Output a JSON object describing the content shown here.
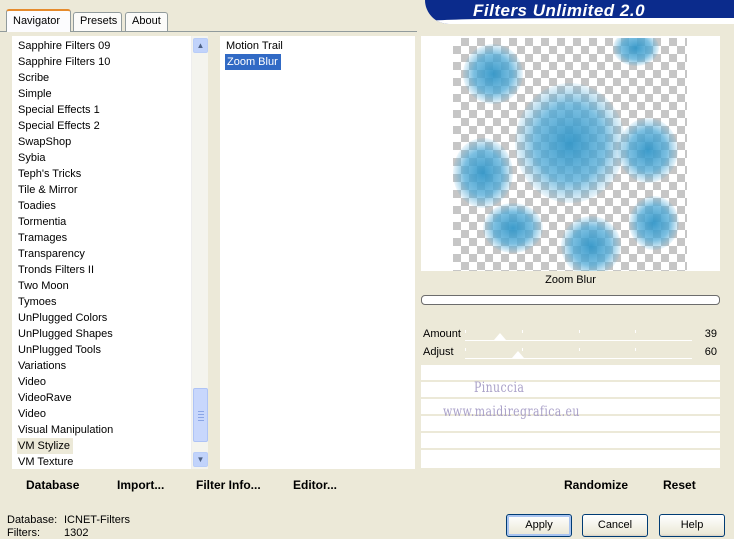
{
  "tabs": [
    {
      "label": "Navigator",
      "active": true
    },
    {
      "label": "Presets",
      "active": false
    },
    {
      "label": "About",
      "active": false
    }
  ],
  "banner": {
    "title": "Filters Unlimited 2.0"
  },
  "categories": {
    "items": [
      "Sapphire Filters 09",
      "Sapphire Filters 10",
      "Scribe",
      "Simple",
      "Special Effects 1",
      "Special Effects 2",
      "SwapShop",
      "Sybia",
      "Teph's Tricks",
      "Tile & Mirror",
      "Toadies",
      "Tormentia",
      "Tramages",
      "Transparency",
      "Tronds Filters II",
      "Two Moon",
      "Tymoes",
      "UnPlugged Colors",
      "UnPlugged Shapes",
      "UnPlugged Tools",
      "Variations",
      "Video",
      "VideoRave",
      "Video",
      "Visual Manipulation",
      "VM Stylize",
      "VM Texture"
    ],
    "selected_index": 25,
    "scroll_up_icon": "chevron-up-icon",
    "scroll_down_icon": "chevron-down-icon"
  },
  "filters": {
    "items": [
      "Motion Trail",
      "Zoom Blur"
    ],
    "selected_index": 1
  },
  "preview": {
    "filter_name": "Zoom Blur",
    "accent_color": "#3a9ccc"
  },
  "sliders": [
    {
      "label": "Amount",
      "value": "39",
      "level": 39
    },
    {
      "label": "Adjust",
      "value": "60",
      "level": 60
    }
  ],
  "watermark": {
    "line1": "Pinuccia",
    "line2": "www.maidiregrafica.eu"
  },
  "toolbar": {
    "database": "Database",
    "import": "Import...",
    "filter_info": "Filter Info...",
    "editor": "Editor...",
    "randomize": "Randomize",
    "reset": "Reset"
  },
  "info": {
    "database_label": "Database:",
    "database_value": "ICNET-Filters",
    "filters_label": "Filters:",
    "filters_value": "1302"
  },
  "buttons": {
    "apply": "Apply",
    "cancel": "Cancel",
    "help": "Help"
  }
}
